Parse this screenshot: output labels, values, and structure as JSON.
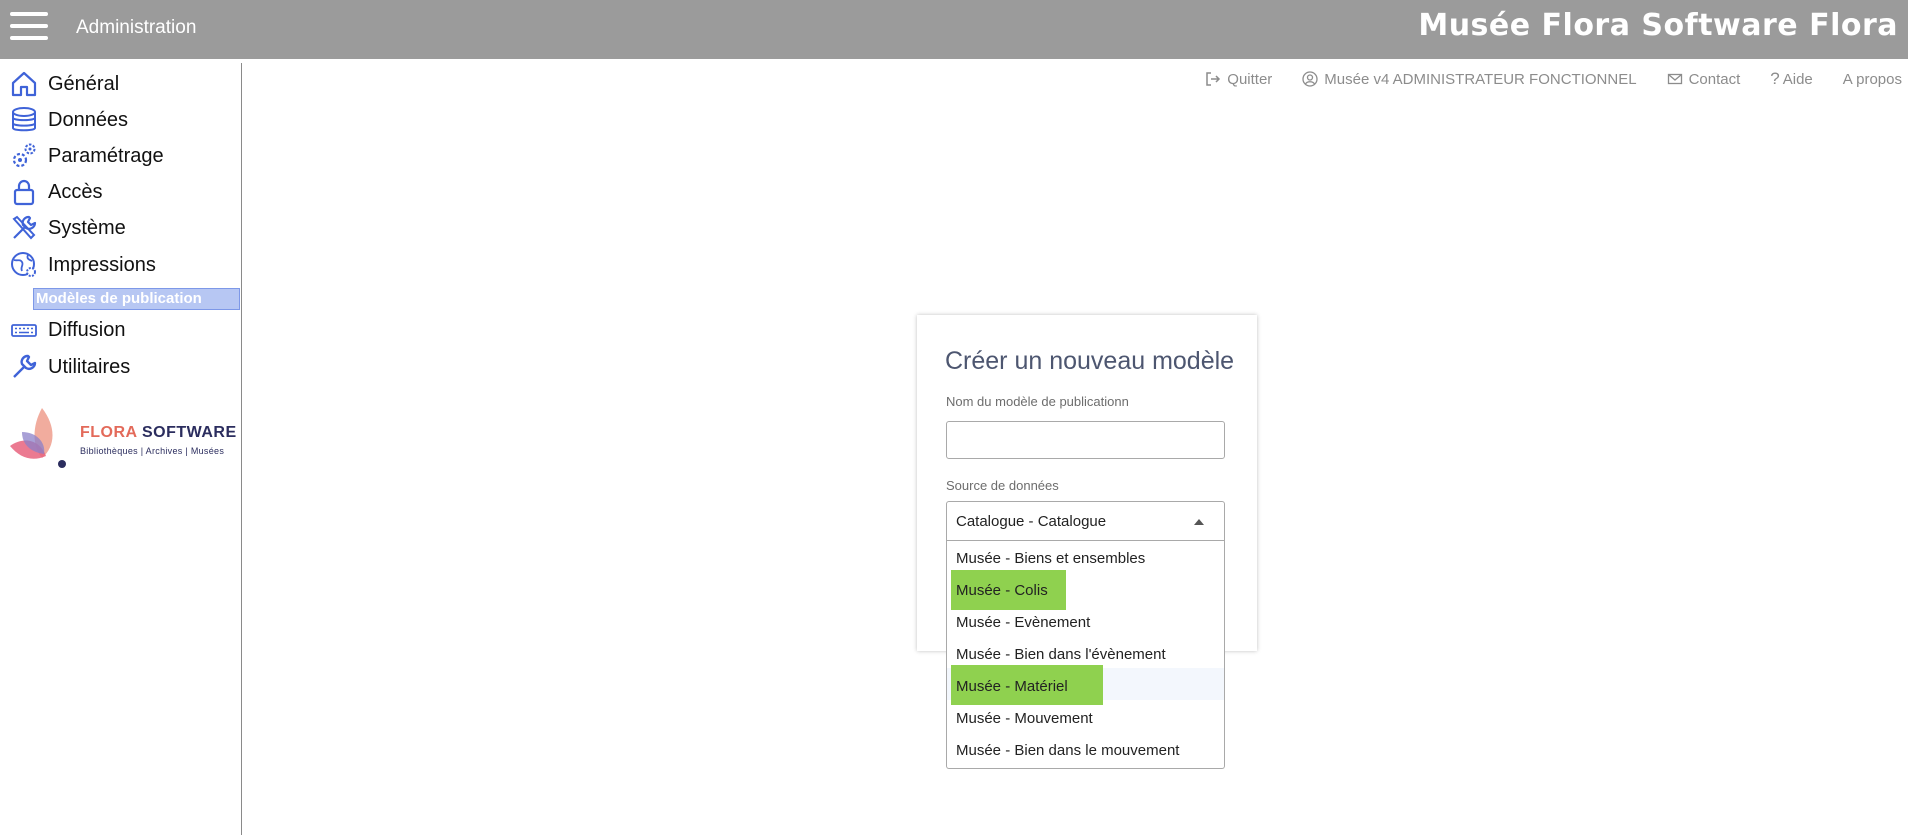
{
  "header": {
    "title": "Administration",
    "brand": "Musée Flora Software Flora"
  },
  "sidebar": {
    "items": [
      {
        "label": "Général",
        "icon": "home-icon"
      },
      {
        "label": "Données",
        "icon": "database-icon"
      },
      {
        "label": "Paramétrage",
        "icon": "gears-icon"
      },
      {
        "label": "Accès",
        "icon": "lock-icon"
      },
      {
        "label": "Système",
        "icon": "tools-icon"
      },
      {
        "label": "Impressions",
        "icon": "globe-gear-icon"
      },
      {
        "label": "Diffusion",
        "icon": "keyboard-icon"
      },
      {
        "label": "Utilitaires",
        "icon": "wrench-icon"
      }
    ],
    "active_subitem": "Modèles de publication"
  },
  "logo": {
    "name_part1": "FLORA",
    "name_part2": "SOFTWARE",
    "tagline": "Bibliothèques | Archives | Musées"
  },
  "toplinks": {
    "quit": "Quitter",
    "user": "Musée v4 ADMINISTRATEUR FONCTIONNEL",
    "contact": "Contact",
    "help": "Aide",
    "about": "A propos"
  },
  "form": {
    "title": "Créer un nouveau modèle",
    "name_label": "Nom du modèle de publicationn",
    "name_value": "",
    "source_label": "Source de données",
    "source_value": "Catalogue - Catalogue",
    "options": [
      "Musée - Biens et ensembles",
      "Musée - Colis",
      "Musée - Evènement",
      "Musée - Bien dans l'évènement",
      "Musée - Matériel",
      "Musée - Mouvement",
      "Musée - Bien dans le mouvement"
    ],
    "highlighted_options": [
      "Musée - Colis",
      "Musée - Matériel"
    ],
    "hovered_option": "Musée - Matériel",
    "highlight_color": "#8fd14f"
  },
  "colors": {
    "topbar": "#9b9b9b",
    "icon_blue": "#3f63d8",
    "subitem_bg": "#b7c7f3"
  }
}
